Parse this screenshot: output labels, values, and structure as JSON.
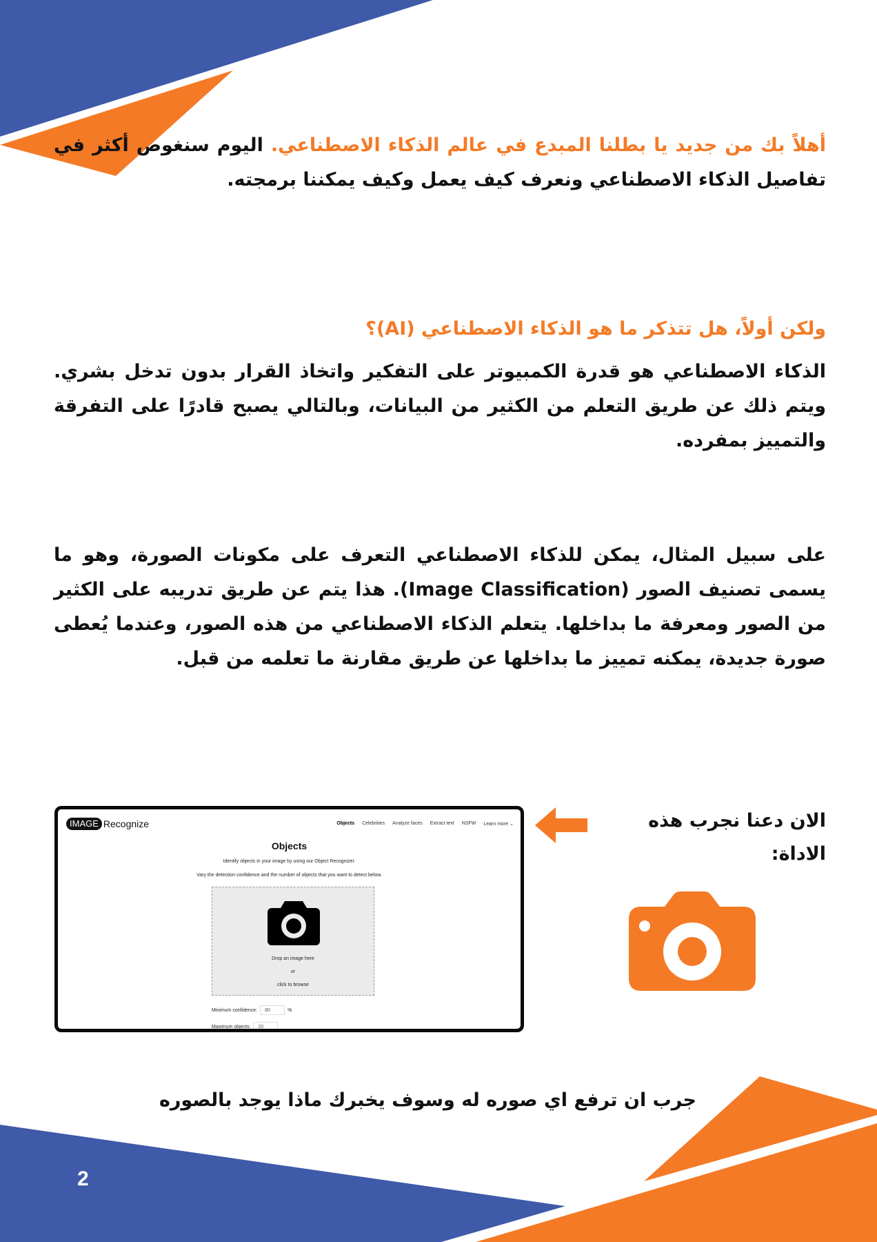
{
  "intro": {
    "highlight": "أهلاً بك من جديد يا بطلنا المبدع في عالم الذكاء الاصطناعي.",
    "rest": " اليوم سنغوص أكثر في تفاصيل الذكاء الاصطناعي ونعرف كيف يعمل وكيف يمكننا برمجته."
  },
  "question_heading": "ولكن أولاً، هل تتذكر ما هو الذكاء الاصطناعي (AI)؟",
  "definition": "الذكاء الاصطناعي هو قدرة الكمبيوتر على التفكير واتخاذ القرار بدون تدخل بشري. ويتم ذلك عن طريق التعلم من الكثير من البيانات، وبالتالي يصبح قادرًا على التفرقة والتمييز بمفرده.",
  "example": "على سبيل المثال، يمكن للذكاء الاصطناعي التعرف على مكونات الصورة، وهو ما يسمى تصنيف الصور (Image Classification). هذا يتم عن طريق تدريبه على الكثير من الصور ومعرفة ما بداخلها. يتعلم الذكاء الاصطناعي من هذه الصور، وعندما يُعطى صورة جديدة، يمكنه تمييز ما بداخلها عن طريق مقارنة ما تعلمه من قبل.",
  "tool_label": "الان دعنا نجرب هذه الاداة:",
  "screenshot": {
    "logo_box": "IMAGE",
    "logo_text": "Recognize",
    "nav": [
      "Objects",
      "Celebrities",
      "Analyze faces",
      "Extract text",
      "NSFW",
      "Learn more"
    ],
    "title": "Objects",
    "subtitle": "Identify objects in your image by using our Object Recognizer.",
    "instruction": "Vary the detection confidence and the number of objects that you want to detect below.",
    "drop_text": "Drop an image here",
    "or_text": "or",
    "browse_text": "click to browse",
    "min_conf_label": "Minimum confidence:",
    "min_conf_value": "80",
    "min_conf_unit": "%",
    "max_obj_label": "Maximum objects:",
    "max_obj_value": "20"
  },
  "bottom_text": "جرب ان ترفع اي صوره له وسوف يخبرك ماذا يوجد بالصوره",
  "page_number": "2",
  "colors": {
    "blue": "#3f5aa8",
    "orange": "#f47a26"
  }
}
